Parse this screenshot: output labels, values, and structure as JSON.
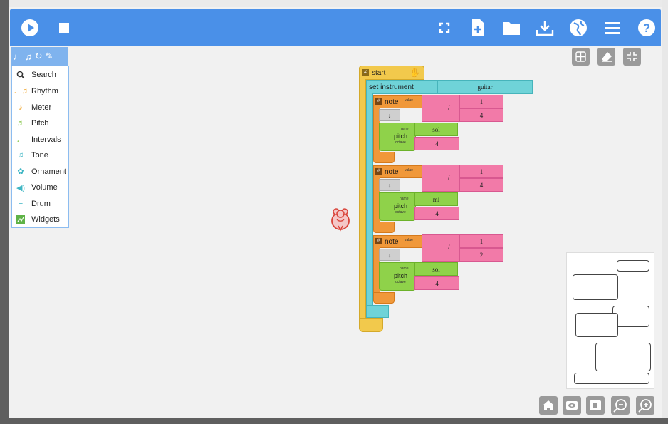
{
  "colors": {
    "toolbar": "#4a90e8",
    "palette_tab": "#7fb3ee",
    "start_block": "#f2c94c",
    "instrument_block": "#6fd3d8",
    "note_block": "#f0983a",
    "number_block": "#f27aa8",
    "pitch_block": "#8fd24a"
  },
  "toolbar": {
    "left_icons": [
      "play-icon",
      "stop-icon"
    ],
    "right_icons": [
      "fullscreen-icon",
      "new-file-icon",
      "open-folder-icon",
      "save-download-icon",
      "language-globe-icon",
      "menu-icon",
      "help-icon"
    ]
  },
  "palette": {
    "items": [
      {
        "label": "Search",
        "icon": "search-icon"
      },
      {
        "label": "Rhythm",
        "icon": "rhythm-icon"
      },
      {
        "label": "Meter",
        "icon": "meter-icon"
      },
      {
        "label": "Pitch",
        "icon": "pitch-icon"
      },
      {
        "label": "Intervals",
        "icon": "intervals-icon"
      },
      {
        "label": "Tone",
        "icon": "tone-icon"
      },
      {
        "label": "Ornament",
        "icon": "ornament-icon"
      },
      {
        "label": "Volume",
        "icon": "volume-icon"
      },
      {
        "label": "Drum",
        "icon": "drum-icon"
      },
      {
        "label": "Widgets",
        "icon": "widgets-icon"
      }
    ]
  },
  "program": {
    "start_label": "start",
    "set_instrument_label": "set instrument",
    "instrument": "guitar",
    "note_label": "note",
    "value_label": "value",
    "pitch_label": "pitch",
    "name_label": "name",
    "octave_label": "octave",
    "divide_symbol": "/",
    "arrow_symbol": "↓",
    "notes": [
      {
        "numerator": "1",
        "denominator": "4",
        "name": "sol",
        "octave": "4"
      },
      {
        "numerator": "1",
        "denominator": "4",
        "name": "mi",
        "octave": "4"
      },
      {
        "numerator": "1",
        "denominator": "2",
        "name": "sol",
        "octave": "4"
      }
    ]
  }
}
